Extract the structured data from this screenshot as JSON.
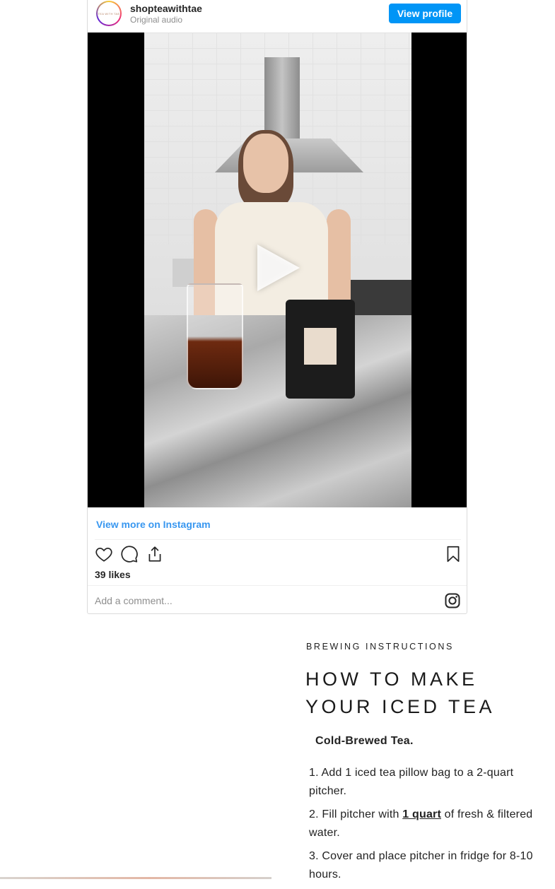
{
  "embed": {
    "username": "shopteawithtae",
    "audio": "Original audio",
    "view_profile_label": "View profile",
    "avatar_text": "TEA WITH TAE",
    "view_more_label": "View more on Instagram",
    "likes": "39 likes",
    "comment_placeholder": "Add a comment...",
    "icons": {
      "like": "heart-icon",
      "comment": "comment-icon",
      "share": "share-icon",
      "save": "bookmark-icon",
      "instagram": "instagram-icon",
      "play": "play-icon"
    }
  },
  "article": {
    "eyebrow": "BREWING INSTRUCTIONS",
    "heading": "HOW TO MAKE YOUR ICED TEA",
    "subhead": "Cold-Brewed Tea.",
    "steps": [
      {
        "before": "1. Add 1 iced tea pillow bag to a 2-quart pitcher.",
        "emphasis": "",
        "after": ""
      },
      {
        "before": "2. Fill pitcher with ",
        "emphasis": "1 quart",
        "after": " of fresh & filtered water."
      },
      {
        "before": "3. Cover and place pitcher in fridge for 8-10 hours.",
        "emphasis": "",
        "after": ""
      }
    ]
  },
  "colors": {
    "accent": "#0095f6",
    "link": "#3897f0",
    "text": "#262626",
    "muted": "#8e8e8e"
  }
}
